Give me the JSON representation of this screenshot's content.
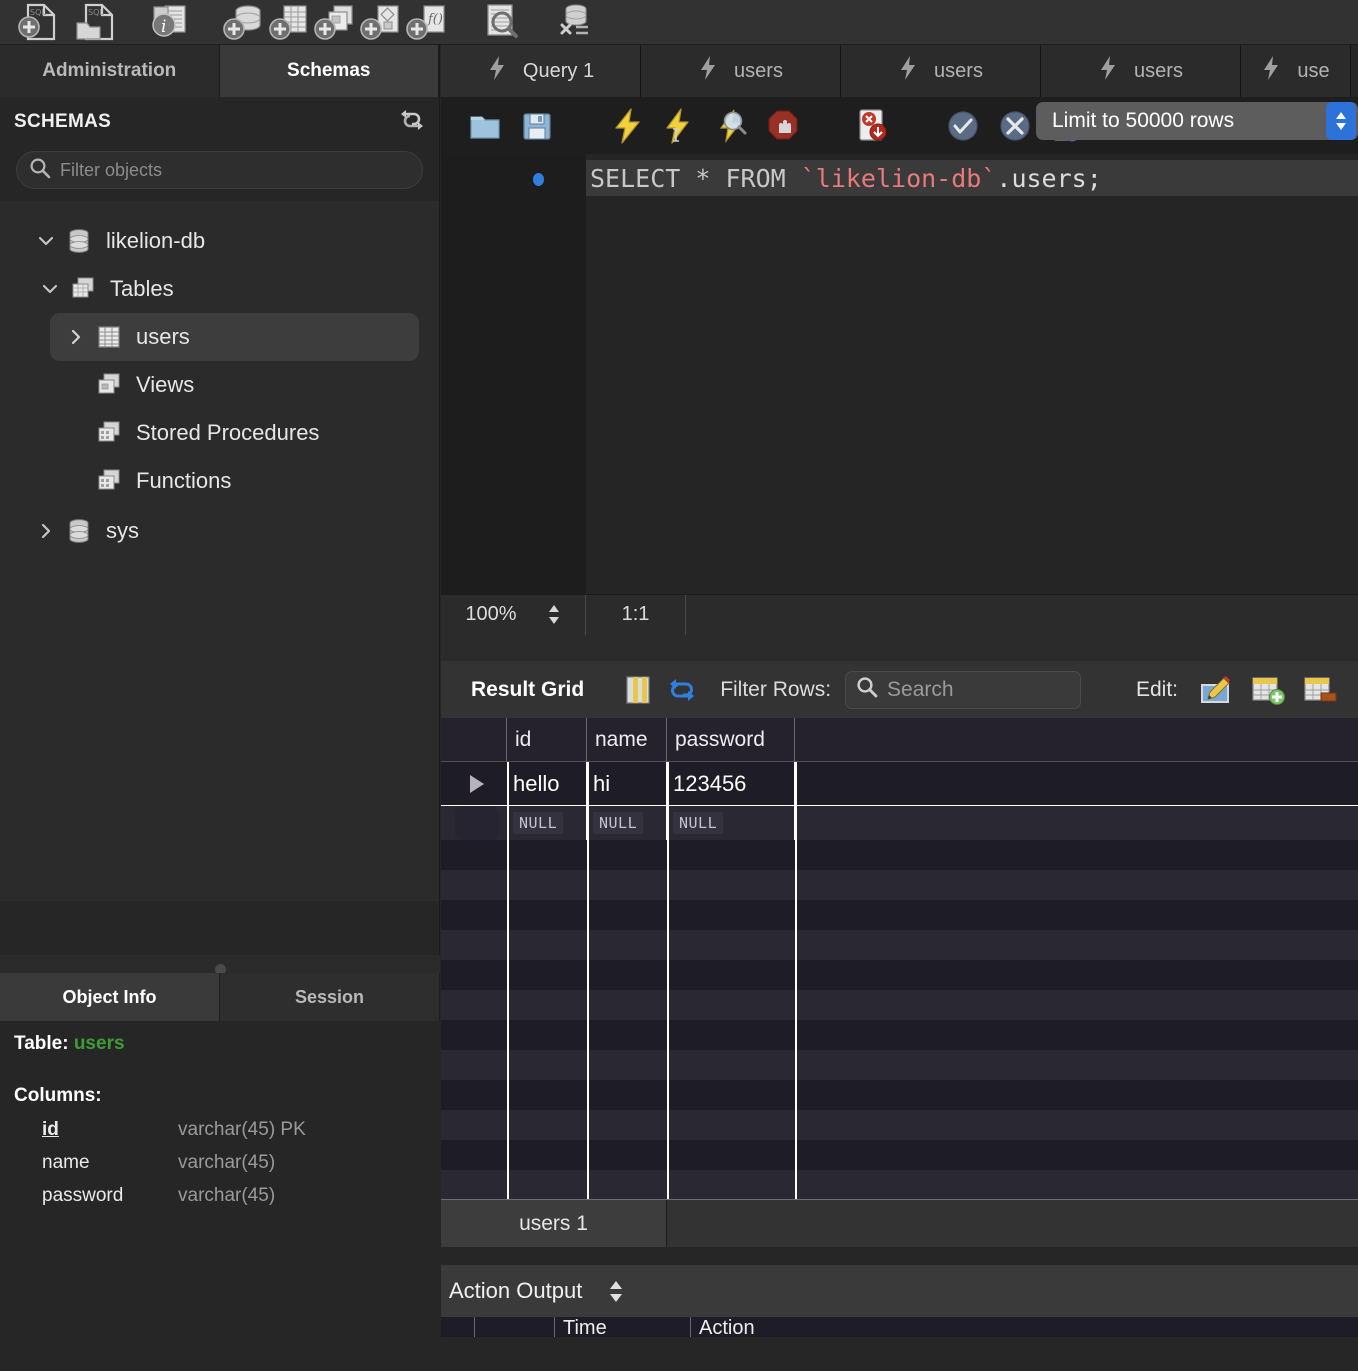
{
  "main_toolbar": {
    "buttons": [
      {
        "name": "new-sql-tab-icon",
        "title": "New SQL Tab"
      },
      {
        "name": "open-sql-script-icon",
        "title": "Open SQL Script"
      },
      {
        "name": "inspector-icon",
        "title": "Inspector"
      },
      {
        "name": "create-schema-icon",
        "title": "Create Schema"
      },
      {
        "name": "create-table-icon",
        "title": "Create Table"
      },
      {
        "name": "create-view-icon",
        "title": "Create View"
      },
      {
        "name": "create-procedure-icon",
        "title": "Create Procedure"
      },
      {
        "name": "create-function-icon",
        "title": "Create Function"
      },
      {
        "name": "search-data-icon",
        "title": "Search Table Data"
      },
      {
        "name": "reconnect-dbms-icon",
        "title": "Reconnect to DBMS"
      }
    ]
  },
  "left_panel": {
    "tabs": [
      {
        "label": "Administration",
        "active": false
      },
      {
        "label": "Schemas",
        "active": true
      }
    ],
    "schemas_title": "SCHEMAS",
    "refresh_icon": "refresh-icon",
    "filter": {
      "placeholder": "Filter objects",
      "value": "",
      "icon": "search-icon"
    },
    "tree": [
      {
        "label": "likelion-db",
        "icon": "database-icon",
        "level": 0,
        "arrow": "down",
        "selected": false
      },
      {
        "label": "Tables",
        "icon": "folder-tables-icon",
        "level": 1,
        "arrow": "down",
        "selected": false
      },
      {
        "label": "users",
        "icon": "table-icon",
        "level": 2,
        "arrow": "right",
        "selected": true
      },
      {
        "label": "Views",
        "icon": "folder-views-icon",
        "level": 2,
        "arrow": "none",
        "selected": false
      },
      {
        "label": "Stored Procedures",
        "icon": "folder-procedures-icon",
        "level": 2,
        "arrow": "none",
        "selected": false
      },
      {
        "label": "Functions",
        "icon": "folder-functions-icon",
        "level": 2,
        "arrow": "none",
        "selected": false
      },
      {
        "label": "sys",
        "icon": "database-icon",
        "level": 0,
        "arrow": "right",
        "selected": false
      }
    ]
  },
  "object_info": {
    "tabs": [
      {
        "label": "Object Info",
        "active": true
      },
      {
        "label": "Session",
        "active": false
      }
    ],
    "table_label": "Table:",
    "table_name": "users",
    "columns_label": "Columns:",
    "columns": [
      {
        "name": "id",
        "type": "varchar(45) PK",
        "pk": true
      },
      {
        "name": "name",
        "type": "varchar(45)",
        "pk": false
      },
      {
        "name": "password",
        "type": "varchar(45)",
        "pk": false
      }
    ]
  },
  "query_tabs": [
    {
      "label": "Query 1",
      "active": true,
      "icon": "lightning-icon"
    },
    {
      "label": "users",
      "active": false,
      "icon": "lightning-icon"
    },
    {
      "label": "users",
      "active": false,
      "icon": "lightning-icon"
    },
    {
      "label": "users",
      "active": false,
      "icon": "lightning-icon"
    },
    {
      "label": "use",
      "active": false,
      "icon": "lightning-icon"
    }
  ],
  "editor_toolbar": {
    "buttons": [
      {
        "name": "open-script-icon",
        "title": "Open a script file in this editor"
      },
      {
        "name": "save-script-icon",
        "title": "Save script to file"
      },
      {
        "name": "execute-icon",
        "title": "Execute the selected portion of the script"
      },
      {
        "name": "execute-current-statement-icon",
        "title": "Execute current statement"
      },
      {
        "name": "explain-icon",
        "title": "Execute explain statement"
      },
      {
        "name": "stop-icon",
        "title": "Stop the query being executed"
      },
      {
        "name": "toggle-stop-on-error-icon",
        "title": "Toggle whether execution should stop or continue if errors occur"
      },
      {
        "name": "commit-icon",
        "title": "Commit"
      },
      {
        "name": "rollback-icon",
        "title": "Rollback"
      },
      {
        "name": "autocommit-icon",
        "title": "Toggle autocommit mode"
      }
    ],
    "limit_label": "Limit to 50000 rows"
  },
  "sql_editor": {
    "line_number": "1",
    "breakpoint": true,
    "statement_parts": [
      {
        "text": "SELECT * FROM ",
        "cls": "kw"
      },
      {
        "text": "`likelion-db`",
        "cls": "ident"
      },
      {
        "text": ".users;",
        "cls": "plain"
      }
    ],
    "statement_full": "SELECT * FROM `likelion-db`.users;"
  },
  "zoom_bar": {
    "zoom_level": "100%",
    "ratio": "1:1"
  },
  "result_grid": {
    "title": "Result Grid",
    "grid_view_icon": "grid-view-icon",
    "refresh_icon": "refresh-blue-icon",
    "filter_label": "Filter Rows:",
    "search_placeholder": "Search",
    "search_value": "",
    "edit_label": "Edit:",
    "edit_icons": [
      {
        "name": "edit-row-icon"
      },
      {
        "name": "insert-row-icon"
      },
      {
        "name": "delete-row-icon"
      }
    ],
    "columns": [
      "id",
      "name",
      "password"
    ],
    "rows": [
      {
        "id": "hello",
        "name": "hi",
        "password": "123456",
        "marker": true
      },
      {
        "id": "NULL",
        "name": "NULL",
        "password": "NULL",
        "marker": false,
        "is_null": true
      }
    ],
    "empty_row_count": 11
  },
  "result_tabs": [
    {
      "label": "users 1",
      "active": true
    }
  ],
  "action_output": {
    "title": "Action Output",
    "columns": [
      "",
      "Time",
      "Action"
    ]
  }
}
